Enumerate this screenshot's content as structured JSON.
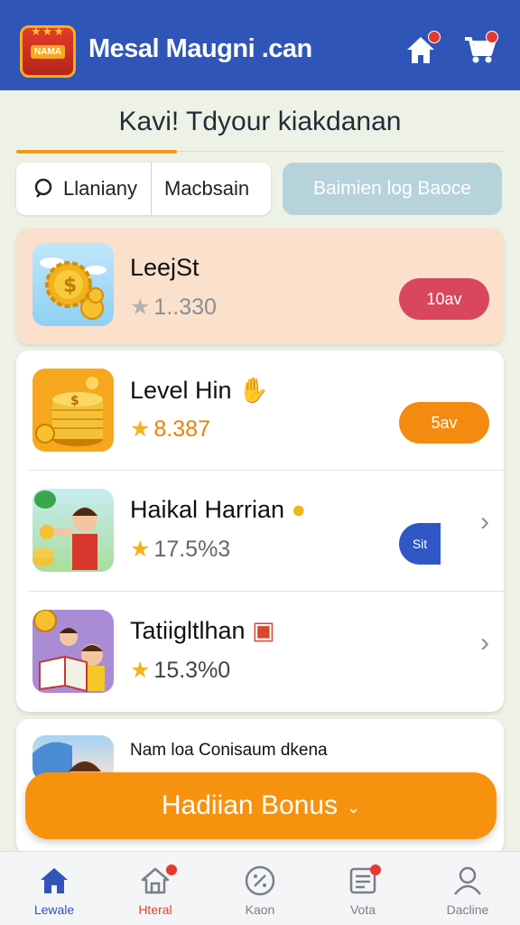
{
  "header": {
    "logo_text": "NAMA",
    "title": "Mesal Maugni .can"
  },
  "page": {
    "heading": "Kavi! Tdyour kiakdanan"
  },
  "filters": {
    "segment_1": "Llaniany",
    "segment_2": "Macbsain",
    "secondary_button": "Baimien log Baoce"
  },
  "items": [
    {
      "title": "LeejSt",
      "rating": "1..330",
      "action": "10av",
      "action_color": "#d9475f",
      "highlighted": true
    },
    {
      "title": "Level Hin",
      "rating": "8.387",
      "action": "5av",
      "action_color": "#f38b10"
    },
    {
      "title": "Haikal Harrian",
      "rating": "17.5%3",
      "action": "Sit",
      "action_color": "#2f58c6"
    },
    {
      "title": "Tatiigltlhan",
      "rating": "15.3%0"
    }
  ],
  "partial_item": {
    "title": "Nam loa Conisaum dkena"
  },
  "bonus_button": {
    "label": "Hadiian Bonus"
  },
  "bottom_nav": [
    {
      "label": "Lewale",
      "icon": "home-icon",
      "active": true
    },
    {
      "label": "Hteral",
      "icon": "shop-icon"
    },
    {
      "label": "Kaon",
      "icon": "timer-icon"
    },
    {
      "label": "Vota",
      "icon": "list-icon"
    },
    {
      "label": "Dacline",
      "icon": "user-icon"
    }
  ],
  "colors": {
    "header_bg": "#2f55b8",
    "accent_orange": "#f7920f",
    "active_nav": "#2f55b8",
    "nav_red": "#d9472f"
  }
}
